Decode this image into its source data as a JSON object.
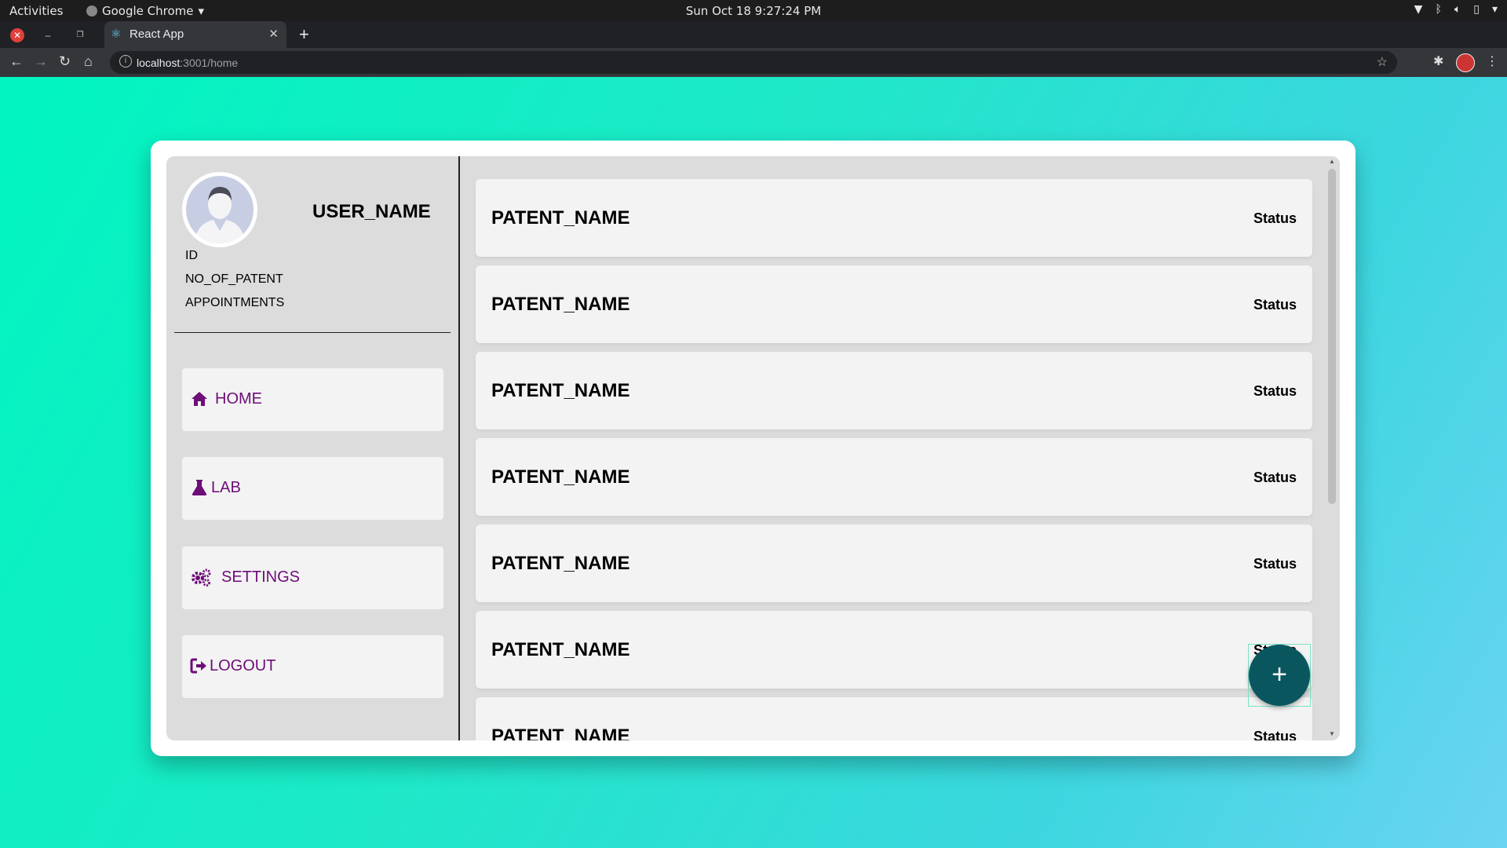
{
  "os_bar": {
    "activities": "Activities",
    "app_name": "Google Chrome",
    "clock": "Sun Oct 18  9:27:24 PM"
  },
  "browser": {
    "tab_title": "React App",
    "url_host": "localhost",
    "url_rest": ":3001/home"
  },
  "profile": {
    "username": "USER_NAME",
    "id_label": "ID",
    "patents_label": "NO_OF_PATENT",
    "appointments_label": "APPOINTMENTS"
  },
  "nav": {
    "home": "HOME",
    "lab": "LAB",
    "settings": "SETTINGS",
    "logout": "LOGOUT"
  },
  "patents": [
    {
      "name": "PATENT_NAME",
      "status": "Status"
    },
    {
      "name": "PATENT_NAME",
      "status": "Status"
    },
    {
      "name": "PATENT_NAME",
      "status": "Status"
    },
    {
      "name": "PATENT_NAME",
      "status": "Status"
    },
    {
      "name": "PATENT_NAME",
      "status": "Status"
    },
    {
      "name": "PATENT_NAME",
      "status": "Status"
    },
    {
      "name": "PATENT_NAME",
      "status": "Status"
    }
  ],
  "fab": {
    "label": "+"
  },
  "colors": {
    "nav_text": "#6e0d78",
    "fab": "#0a565f",
    "panel": "#dcdcdc",
    "gradient_start": "#00f5c0",
    "gradient_end": "#6bd4f2"
  }
}
